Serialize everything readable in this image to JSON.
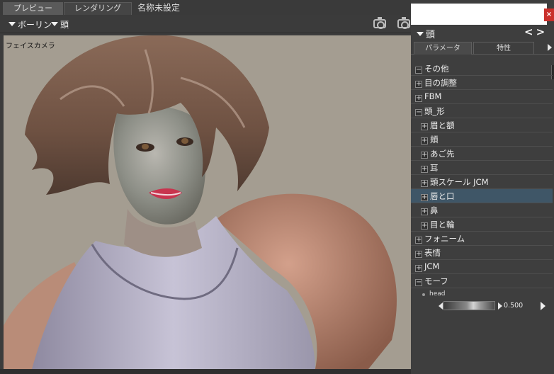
{
  "tabs": [
    {
      "label": "プレビュー",
      "active": true
    },
    {
      "label": "レンダリング",
      "active": false
    },
    {
      "label": "名称未設定",
      "active": false
    }
  ],
  "viewport_toolbar": {
    "figure_dropdown": "ボーリン",
    "part_dropdown": "頭",
    "icons": [
      "camera-icon",
      "camera-icon"
    ]
  },
  "viewport": {
    "camera_label": "フェイスカメラ"
  },
  "panel": {
    "title": "頭",
    "nav": "<>",
    "close": "×",
    "tabs": [
      {
        "label": "パラメータ",
        "active": true
      },
      {
        "label": "特性",
        "active": false
      }
    ],
    "tree": [
      {
        "label": "その他",
        "indent": 0,
        "toggle": "−",
        "selected": false
      },
      {
        "label": "目の調整",
        "indent": 0,
        "toggle": "+",
        "selected": false
      },
      {
        "label": "FBM",
        "indent": 0,
        "toggle": "+",
        "selected": false
      },
      {
        "label": "頭_形",
        "indent": 0,
        "toggle": "−",
        "selected": false
      },
      {
        "label": "眉と額",
        "indent": 1,
        "toggle": "+",
        "selected": false
      },
      {
        "label": "頬",
        "indent": 1,
        "toggle": "+",
        "selected": false
      },
      {
        "label": "あご先",
        "indent": 1,
        "toggle": "+",
        "selected": false
      },
      {
        "label": "耳",
        "indent": 1,
        "toggle": "+",
        "selected": false
      },
      {
        "label": "頭スケール JCM",
        "indent": 1,
        "toggle": "+",
        "selected": false
      },
      {
        "label": "唇と口",
        "indent": 1,
        "toggle": "+",
        "selected": true
      },
      {
        "label": "鼻",
        "indent": 1,
        "toggle": "+",
        "selected": false
      },
      {
        "label": "目と輪",
        "indent": 1,
        "toggle": "+",
        "selected": false
      },
      {
        "label": "フォニーム",
        "indent": 0,
        "toggle": "+",
        "selected": false
      },
      {
        "label": "表情",
        "indent": 0,
        "toggle": "+",
        "selected": false
      },
      {
        "label": "JCM",
        "indent": 0,
        "toggle": "+",
        "selected": false
      },
      {
        "label": "モーフ",
        "indent": 0,
        "toggle": "−",
        "selected": false
      }
    ],
    "morph": {
      "name": "head",
      "value": "0.500"
    }
  }
}
